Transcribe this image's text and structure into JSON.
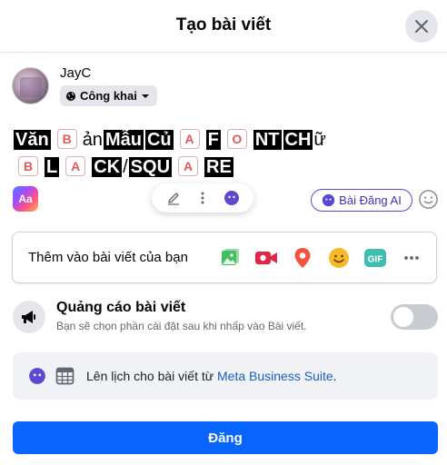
{
  "header": {
    "title": "Tạo bài viết",
    "close_icon": "close-icon"
  },
  "user": {
    "name": "JayC",
    "privacy_label": "Công khai",
    "privacy_icon": "globe-icon"
  },
  "post_text": {
    "line1": [
      "Văn",
      "B",
      "ản",
      "Mẫu",
      "Củ",
      "A",
      "F",
      "O",
      "NT",
      "CH",
      "ữ"
    ],
    "line2": [
      "B",
      "L",
      "A",
      "CK",
      "/",
      "SQU",
      "A",
      "RE"
    ]
  },
  "toolbar": {
    "aa_label": "Aa",
    "ai_label": "Bài Đăng AI"
  },
  "add_to_post": {
    "label": "Thêm vào bài viết của bạn",
    "icons": [
      "photo-icon",
      "video-icon",
      "location-pin-icon",
      "feeling-emoji-icon",
      "gif-icon",
      "more-dots-icon"
    ],
    "gif_label": "GIF"
  },
  "ads": {
    "title": "Quảng cáo bài viết",
    "subtitle": "Bạn sẽ chọn phần cài đặt sau khi nhấp vào Bài viết.",
    "toggle_on": false
  },
  "schedule": {
    "text": "Lên lịch cho bài viết từ ",
    "link": "Meta Business Suite",
    "suffix": "."
  },
  "post_button": "Đăng",
  "colors": {
    "primary": "#0866ff",
    "ai_purple": "#5b4ad1"
  }
}
